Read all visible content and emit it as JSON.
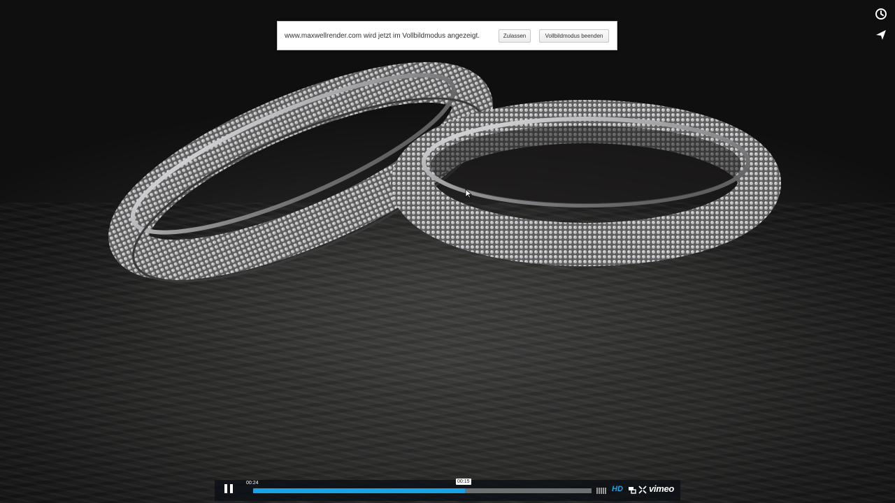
{
  "fullscreen_notice": {
    "message": "www.maxwellrender.com wird jetzt im Vollbildmodus angezeigt.",
    "allow_label": "Zulassen",
    "exit_label": "Vollbildmodus beenden"
  },
  "side_actions": {
    "watch_later_icon": "clock-icon",
    "share_icon": "send-icon"
  },
  "player": {
    "elapsed_time": "00:24",
    "hover_time": "00:15",
    "progress_played": 0.625,
    "progress_loaded": 0.625,
    "hd_label": "HD",
    "brand": "vimeo",
    "accent_color": "#1aa4e8",
    "pause_icon": "pause-icon",
    "volume_icon": "volume-bars-icon",
    "scale_icon": "scale-icon",
    "fullscreen_icon": "fullscreen-icon"
  }
}
